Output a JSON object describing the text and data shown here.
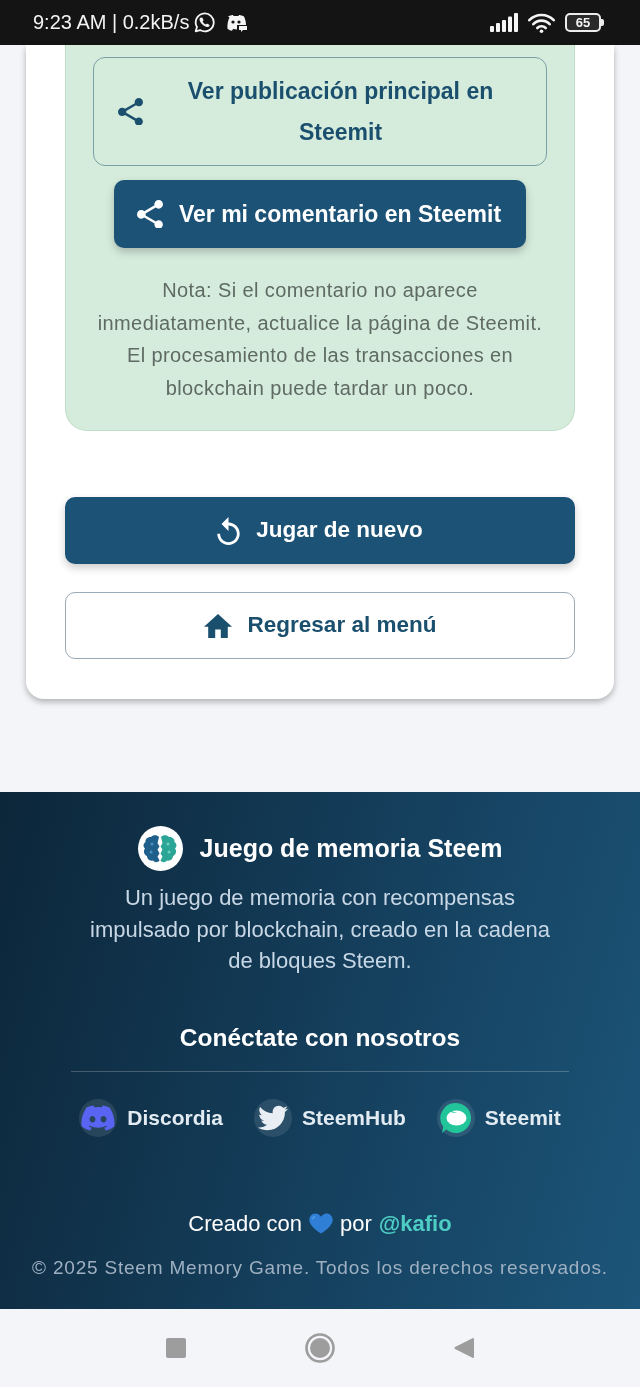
{
  "status_bar": {
    "text": "9:23 AM | 0.2kB/s",
    "battery": "65"
  },
  "share_panel": {
    "buttons": [
      {
        "kind": "outline",
        "label": "Ver publicación principal en Steemit"
      },
      {
        "kind": "filled",
        "label": "Ver mi comentario en Steemit"
      }
    ],
    "note": "Nota: Si el comentario no aparece inmediatamente, actualice la página de Steemit. El procesamiento de las transacciones en blockchain puede tardar un poco."
  },
  "actions": [
    {
      "kind": "filled",
      "label": "Jugar de nuevo"
    },
    {
      "kind": "outline",
      "label": "Regresar al menú"
    }
  ],
  "footer": {
    "title": "Juego de memoria Steem",
    "description": "Un juego de memoria con recompensas impulsado por blockchain, creado en la cadena de bloques Steem.",
    "social_heading": "Conéctate con nosotros",
    "social_links": [
      "Discordia",
      "SteemHub",
      "Steemit"
    ],
    "credit": {
      "before": "Creado con",
      "after": "por",
      "author": "@kafio"
    },
    "copyright": "© 2025 Steem Memory Game. Todos los derechos reservados."
  }
}
